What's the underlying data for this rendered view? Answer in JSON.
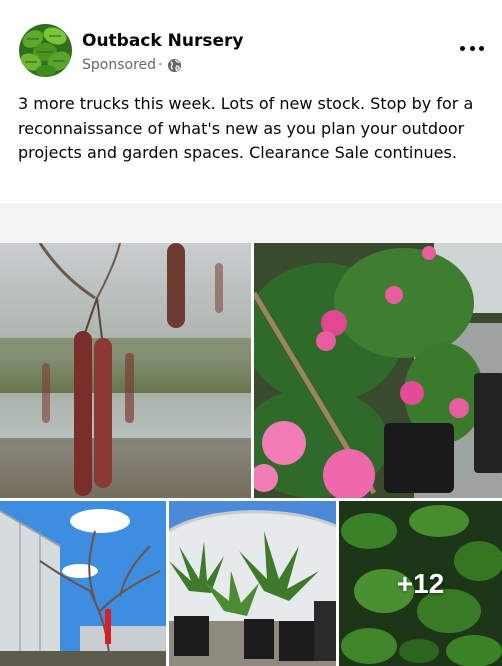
{
  "post": {
    "page_name": "Outback Nursery",
    "sponsored_label": "Sponsored",
    "separator": "·",
    "privacy_icon": "globe-icon",
    "more_icon": "ellipsis-icon",
    "text": "3 more trucks this week. Lots of new stock. Stop by for a reconnaissance of what's new as you plan your outdoor projects and garden spaces. Clearance Sale continues."
  },
  "photos": {
    "extra_count_label": "+12",
    "items": [
      {
        "subject": "alder catkins"
      },
      {
        "subject": "pink camellias in pots"
      },
      {
        "subject": "bare fruit tree and greenhouse"
      },
      {
        "subject": "potted palms in greenhouse"
      },
      {
        "subject": "green leafy shrub"
      }
    ]
  },
  "colors": {
    "text_primary": "#050505",
    "text_secondary": "#65676b",
    "divider": "#f4f4f4"
  }
}
